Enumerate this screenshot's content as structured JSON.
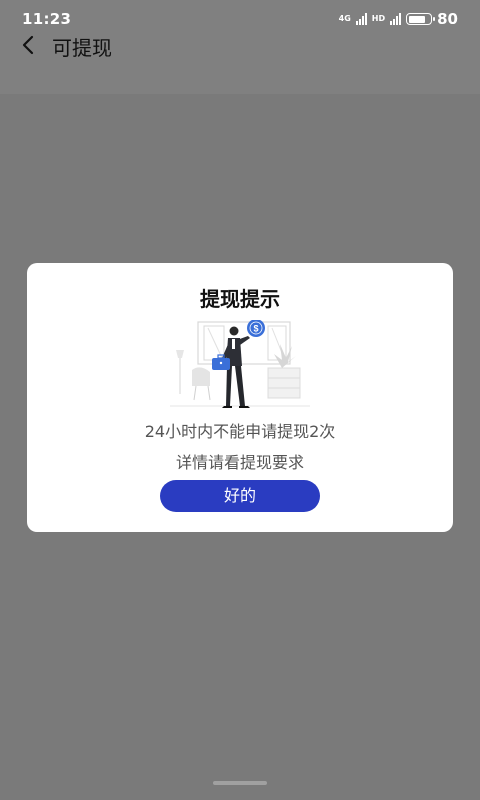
{
  "status_bar": {
    "time": "11:23",
    "network_tag": "4G",
    "hd_tag": "HD",
    "battery": "80"
  },
  "nav": {
    "title": "可提现",
    "back_icon": "chevron-left-icon"
  },
  "dialog": {
    "title": "提现提示",
    "message_line1": "24小时内不能申请提现2次",
    "message_line2": "详情请看提现要求",
    "ok_label": "好的",
    "illustration": "man-with-briefcase-dollar-icon"
  },
  "colors": {
    "overlay": "#7a7a7a",
    "button": "#2a3cc1",
    "dialog_bg": "#ffffff"
  }
}
